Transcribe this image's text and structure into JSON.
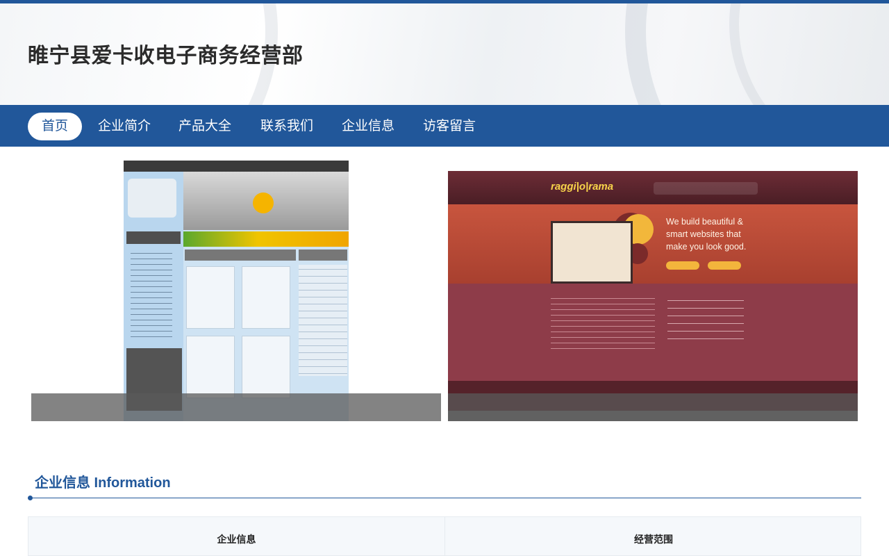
{
  "site": {
    "title": "睢宁县爱卡收电子商务经营部"
  },
  "nav": {
    "items": [
      {
        "label": "首页",
        "active": true
      },
      {
        "label": "企业简介",
        "active": false
      },
      {
        "label": "产品大全",
        "active": false
      },
      {
        "label": "联系我们",
        "active": false
      },
      {
        "label": "企业信息",
        "active": false
      },
      {
        "label": "访客留言",
        "active": false
      }
    ]
  },
  "slides": [
    {
      "image": "electronics-store-template-thumbnail"
    },
    {
      "image": "raggiorama-template-thumbnail",
      "logo_text": "raggi|o|rama",
      "tagline": "We build beautiful & smart websites that make you look good."
    }
  ],
  "section": {
    "title": "企业信息 Information",
    "columns": [
      "企业信息",
      "经营范围"
    ]
  },
  "colors": {
    "brand": "#21579a",
    "background": "#ffffff"
  }
}
